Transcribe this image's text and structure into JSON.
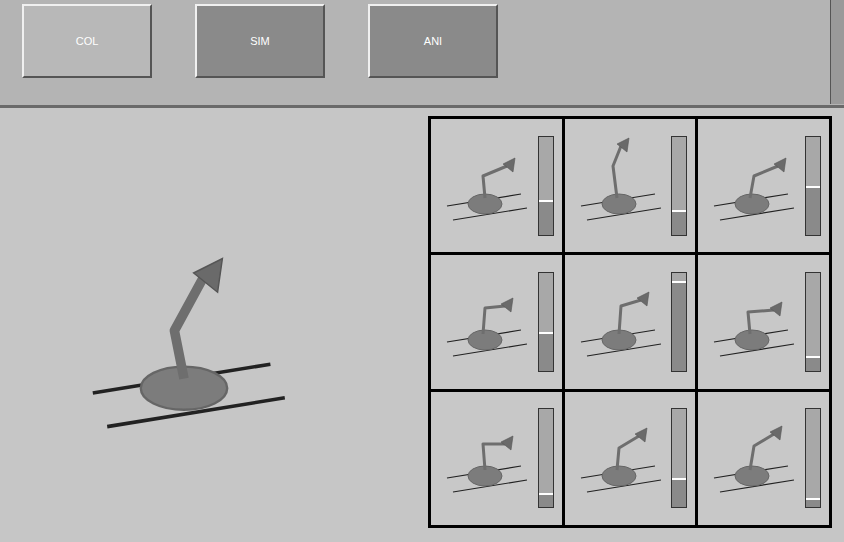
{
  "toolbar": {
    "buttons": [
      {
        "label": "COL",
        "selected": false
      },
      {
        "label": "SIM",
        "selected": true
      },
      {
        "label": "ANI",
        "selected": true
      }
    ]
  },
  "grid": {
    "cells": [
      {
        "level": 0.35
      },
      {
        "level": 0.25
      },
      {
        "level": 0.5
      },
      {
        "level": 0.4
      },
      {
        "level": 0.92
      },
      {
        "level": 0.15
      },
      {
        "level": 0.15
      },
      {
        "level": 0.3
      },
      {
        "level": 0.1
      }
    ]
  }
}
